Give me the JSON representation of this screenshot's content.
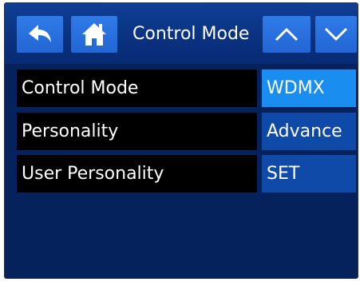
{
  "header": {
    "title": "Control Mode",
    "icons": {
      "back": "back-arrow-icon",
      "home": "home-icon",
      "up": "chevron-up-icon",
      "down": "chevron-down-icon"
    }
  },
  "rows": [
    {
      "label": "Control Mode",
      "value": "WDMX",
      "selected": true
    },
    {
      "label": "Personality",
      "value": "Advance",
      "selected": false
    },
    {
      "label": "User Personality",
      "value": "SET",
      "selected": false
    }
  ],
  "colors": {
    "background": "#06225c",
    "header": "#0a3281",
    "button": "#2266d4",
    "value_selected": "#1a8ef0",
    "value_normal": "#0f4aa8",
    "label_bg": "#000000",
    "text": "#ffffff"
  }
}
